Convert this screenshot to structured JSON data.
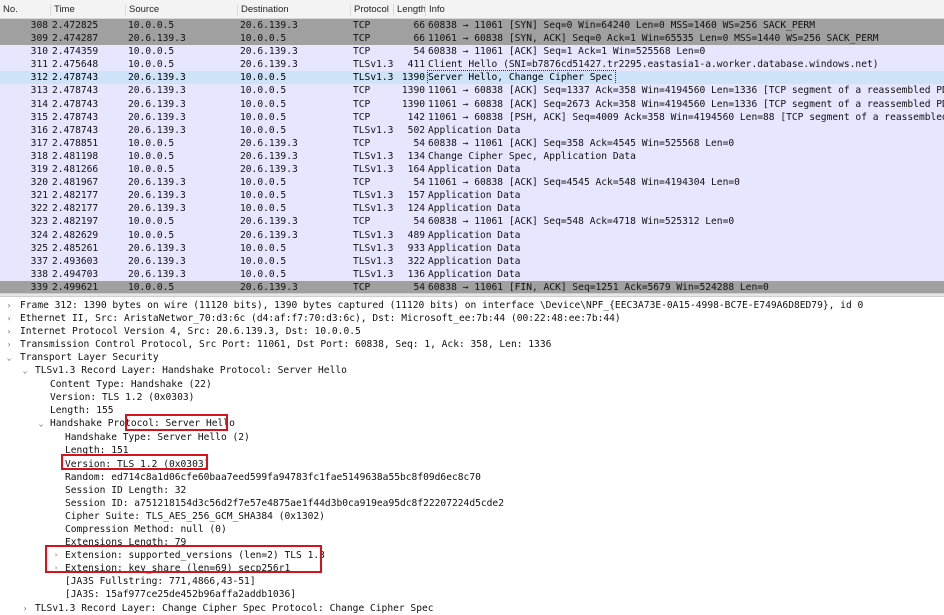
{
  "columns": [
    "No.",
    "Time",
    "Source",
    "Destination",
    "Protocol",
    "Length",
    "Info"
  ],
  "packets": [
    {
      "no": "308",
      "time": "2.472825",
      "src": "10.0.0.5",
      "dst": "20.6.139.3",
      "proto": "TCP",
      "len": "66",
      "info": "60838 → 11061 [SYN] Seq=0 Win=64240 Len=0 MSS=1460 WS=256 SACK_PERM",
      "style": "gray"
    },
    {
      "no": "309",
      "time": "2.474287",
      "src": "20.6.139.3",
      "dst": "10.0.0.5",
      "proto": "TCP",
      "len": "66",
      "info": "11061 → 60838 [SYN, ACK] Seq=0 Ack=1 Win=65535 Len=0 MSS=1440 WS=256 SACK_PERM",
      "style": "gray"
    },
    {
      "no": "310",
      "time": "2.474359",
      "src": "10.0.0.5",
      "dst": "20.6.139.3",
      "proto": "TCP",
      "len": "54",
      "info": "60838 → 11061 [ACK] Seq=1 Ack=1 Win=525568 Len=0",
      "style": "lav"
    },
    {
      "no": "311",
      "time": "2.475648",
      "src": "10.0.0.5",
      "dst": "20.6.139.3",
      "proto": "TLSv1.3",
      "len": "411",
      "info": "Client Hello (SNI=b7876cd51427.tr2295.eastasia1-a.worker.database.windows.net)",
      "style": "lav"
    },
    {
      "no": "312",
      "time": "2.478743",
      "src": "20.6.139.3",
      "dst": "10.0.0.5",
      "proto": "TLSv1.3",
      "len": "1390",
      "info": "Server Hello, Change Cipher Spec",
      "style": "selected"
    },
    {
      "no": "313",
      "time": "2.478743",
      "src": "20.6.139.3",
      "dst": "10.0.0.5",
      "proto": "TCP",
      "len": "1390",
      "info": "11061 → 60838 [ACK] Seq=1337 Ack=358 Win=4194560 Len=1336 [TCP segment of a reassembled PDU]",
      "style": "lav"
    },
    {
      "no": "314",
      "time": "2.478743",
      "src": "20.6.139.3",
      "dst": "10.0.0.5",
      "proto": "TCP",
      "len": "1390",
      "info": "11061 → 60838 [ACK] Seq=2673 Ack=358 Win=4194560 Len=1336 [TCP segment of a reassembled PDU]",
      "style": "lav"
    },
    {
      "no": "315",
      "time": "2.478743",
      "src": "20.6.139.3",
      "dst": "10.0.0.5",
      "proto": "TCP",
      "len": "142",
      "info": "11061 → 60838 [PSH, ACK] Seq=4009 Ack=358 Win=4194560 Len=88 [TCP segment of a reassembled PDU]",
      "style": "lav"
    },
    {
      "no": "316",
      "time": "2.478743",
      "src": "20.6.139.3",
      "dst": "10.0.0.5",
      "proto": "TLSv1.3",
      "len": "502",
      "info": "Application Data",
      "style": "lav"
    },
    {
      "no": "317",
      "time": "2.478851",
      "src": "10.0.0.5",
      "dst": "20.6.139.3",
      "proto": "TCP",
      "len": "54",
      "info": "60838 → 11061 [ACK] Seq=358 Ack=4545 Win=525568 Len=0",
      "style": "lav"
    },
    {
      "no": "318",
      "time": "2.481198",
      "src": "10.0.0.5",
      "dst": "20.6.139.3",
      "proto": "TLSv1.3",
      "len": "134",
      "info": "Change Cipher Spec, Application Data",
      "style": "lav"
    },
    {
      "no": "319",
      "time": "2.481266",
      "src": "10.0.0.5",
      "dst": "20.6.139.3",
      "proto": "TLSv1.3",
      "len": "164",
      "info": "Application Data",
      "style": "lav"
    },
    {
      "no": "320",
      "time": "2.481967",
      "src": "20.6.139.3",
      "dst": "10.0.0.5",
      "proto": "TCP",
      "len": "54",
      "info": "11061 → 60838 [ACK] Seq=4545 Ack=548 Win=4194304 Len=0",
      "style": "lav"
    },
    {
      "no": "321",
      "time": "2.482177",
      "src": "20.6.139.3",
      "dst": "10.0.0.5",
      "proto": "TLSv1.3",
      "len": "157",
      "info": "Application Data",
      "style": "lav"
    },
    {
      "no": "322",
      "time": "2.482177",
      "src": "20.6.139.3",
      "dst": "10.0.0.5",
      "proto": "TLSv1.3",
      "len": "124",
      "info": "Application Data",
      "style": "lav"
    },
    {
      "no": "323",
      "time": "2.482197",
      "src": "10.0.0.5",
      "dst": "20.6.139.3",
      "proto": "TCP",
      "len": "54",
      "info": "60838 → 11061 [ACK] Seq=548 Ack=4718 Win=525312 Len=0",
      "style": "lav"
    },
    {
      "no": "324",
      "time": "2.482629",
      "src": "10.0.0.5",
      "dst": "20.6.139.3",
      "proto": "TLSv1.3",
      "len": "489",
      "info": "Application Data",
      "style": "lav"
    },
    {
      "no": "325",
      "time": "2.485261",
      "src": "20.6.139.3",
      "dst": "10.0.0.5",
      "proto": "TLSv1.3",
      "len": "933",
      "info": "Application Data",
      "style": "lav"
    },
    {
      "no": "337",
      "time": "2.493603",
      "src": "20.6.139.3",
      "dst": "10.0.0.5",
      "proto": "TLSv1.3",
      "len": "322",
      "info": "Application Data",
      "style": "lav"
    },
    {
      "no": "338",
      "time": "2.494703",
      "src": "20.6.139.3",
      "dst": "10.0.0.5",
      "proto": "TLSv1.3",
      "len": "136",
      "info": "Application Data",
      "style": "lav"
    },
    {
      "no": "339",
      "time": "2.499621",
      "src": "10.0.0.5",
      "dst": "20.6.139.3",
      "proto": "TCP",
      "len": "54",
      "info": "60838 → 11061 [FIN, ACK] Seq=1251 Ack=5679 Win=524288 Len=0",
      "style": "gray"
    }
  ],
  "details": {
    "frame": "Frame 312: 1390 bytes on wire (11120 bits), 1390 bytes captured (11120 bits) on interface \\Device\\NPF_{EEC3A73E-0A15-4998-BC7E-E749A6D8ED79}, id 0",
    "ethernet": "Ethernet II, Src: AristaNetwor_70:d3:6c (d4:af:f7:70:d3:6c), Dst: Microsoft_ee:7b:44 (00:22:48:ee:7b:44)",
    "ip": "Internet Protocol Version 4, Src: 20.6.139.3, Dst: 10.0.0.5",
    "tcp": "Transmission Control Protocol, Src Port: 11061, Dst Port: 60838, Seq: 1, Ack: 358, Len: 1336",
    "tls": "Transport Layer Security",
    "record_layer": "TLSv1.3 Record Layer: Handshake Protocol: Server Hello",
    "content_type": "Content Type: Handshake (22)",
    "version": "Version: TLS 1.2 (0x0303)",
    "length": "Length: 155",
    "handshake_protocol_label": "Handshake Protocol: ",
    "handshake_protocol_value": "Server Hello",
    "handshake_type": "Handshake Type: Server Hello (2)",
    "hs_length": "Length: 151",
    "hs_version": "Version: TLS 1.2 (0x0303)",
    "random": "Random: ed714c8a1d06cfe60baa7eed599fa94783fc1fae5149638a55bc8f09d6ec8c70",
    "session_id_length": "Session ID Length: 32",
    "session_id": "Session ID: a751218154d3c56d2f7e57e4875ae1f44d3b0ca919ea95dc8f22207224d5cde2",
    "cipher_suite": "Cipher Suite: TLS_AES_256_GCM_SHA384 (0x1302)",
    "compression": "Compression Method: null (0)",
    "ext_length": "Extensions Length: 79",
    "ext_supported_versions": "Extension: supported_versions (len=2) TLS 1.3",
    "ext_key_share": "Extension: key_share (len=69) secp256r1",
    "ja3s_full": "[JA3S Fullstring: 771,4866,43-51]",
    "ja3s": "[JA3S: 15af977ce25de452b96affa2addb1036]",
    "record_layer2": "TLSv1.3 Record Layer: Change Cipher Spec Protocol: Change Cipher Spec"
  }
}
